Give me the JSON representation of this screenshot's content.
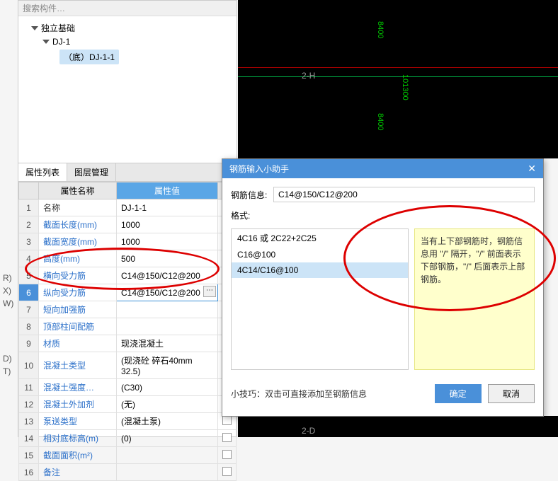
{
  "search_placeholder": "搜索构件…",
  "tree": {
    "root": "独立基础",
    "child": "DJ-1",
    "leaf": "（底）DJ-1-1"
  },
  "tabs": {
    "prop": "属性列表",
    "layer": "图层管理"
  },
  "headers": {
    "name": "属性名称",
    "value": "属性值"
  },
  "rows": [
    {
      "n": "1",
      "name": "名称",
      "val": "DJ-1-1",
      "black": true
    },
    {
      "n": "2",
      "name": "截面长度(mm)",
      "val": "1000",
      "cb": true
    },
    {
      "n": "3",
      "name": "截面宽度(mm)",
      "val": "1000",
      "cb": true
    },
    {
      "n": "4",
      "name": "高度(mm)",
      "val": "500",
      "cb": true
    },
    {
      "n": "5",
      "name": "横向受力筋",
      "val": "C14@150/C12@200",
      "cb": true
    },
    {
      "n": "6",
      "name": "纵向受力筋",
      "val": "C14@150/C12@200",
      "cb": true,
      "sel": true,
      "edit": true
    },
    {
      "n": "7",
      "name": "短向加强筋",
      "val": "",
      "cb": true
    },
    {
      "n": "8",
      "name": "顶部柱间配筋",
      "val": "",
      "cb": true
    },
    {
      "n": "9",
      "name": "材质",
      "val": "现浇混凝土",
      "cb": true
    },
    {
      "n": "10",
      "name": "混凝土类型",
      "val": "(现浇砼 碎石40mm 32.5)",
      "cb": true
    },
    {
      "n": "11",
      "name": "混凝土强度…",
      "val": "(C30)",
      "cb": true
    },
    {
      "n": "12",
      "name": "混凝土外加剂",
      "val": "(无)",
      "cb": true
    },
    {
      "n": "13",
      "name": "泵送类型",
      "val": "(混凝土泵)",
      "cb": true
    },
    {
      "n": "14",
      "name": "相对底标高(m)",
      "val": "(0)",
      "cb": true
    },
    {
      "n": "15",
      "name": "截面面积(m²)",
      "val": "",
      "cb": true
    },
    {
      "n": "16",
      "name": "备注",
      "val": "",
      "cb": true
    }
  ],
  "side": [
    "",
    "R)",
    "X)",
    "W)",
    "",
    "",
    "D)",
    "T)"
  ],
  "canvas": {
    "dim1": "8400",
    "dim2": "101300",
    "dim3": "8400",
    "label1": "2-H",
    "label2": "2-D"
  },
  "dialog": {
    "title": "钢筋输入小助手",
    "info_label": "钢筋信息:",
    "info_value": "C14@150/C12@200",
    "format_label": "格式:",
    "formats": [
      "4C16 或 2C22+2C25",
      "C16@100",
      "4C14/C16@100"
    ],
    "tip": "当有上下部钢筋时，钢筋信息用 \"/\" 隔开，\"/\" 前面表示下部钢筋，\"/\" 后面表示上部钢筋。",
    "foot_tip": "小技巧：双击可直接添加至钢筋信息",
    "ok": "确定",
    "cancel": "取消"
  }
}
